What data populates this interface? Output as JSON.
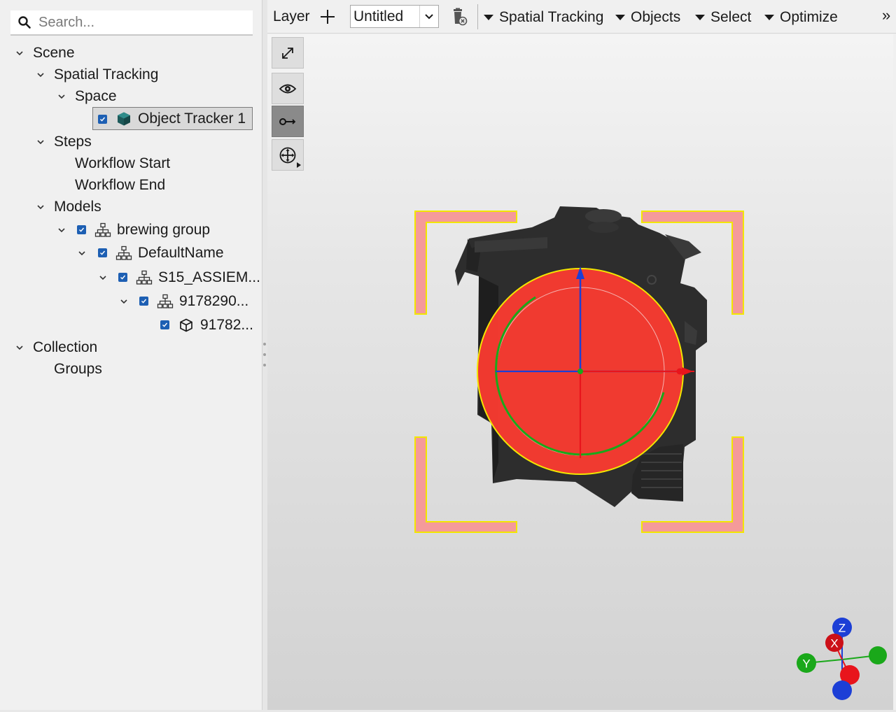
{
  "search": {
    "placeholder": "Search..."
  },
  "tree": {
    "scene": "Scene",
    "spatial_tracking": "Spatial Tracking",
    "space": "Space",
    "object_tracker": "Object Tracker 1",
    "steps": "Steps",
    "workflow_start": "Workflow Start",
    "workflow_end": "Workflow End",
    "models": "Models",
    "brewing_group": "brewing group",
    "default_name": "DefaultName",
    "s15": "S15_ASSIEM...",
    "part_group": "9178290...",
    "part_mesh": "91782...",
    "collection": "Collection",
    "groups": "Groups"
  },
  "toolbar": {
    "layer_label": "Layer",
    "layer_value": "Untitled",
    "spatial_tracking": "Spatial Tracking",
    "objects": "Objects",
    "select": "Select",
    "optimize": "Optimize",
    "overflow": "»"
  },
  "axis_gizmo": {
    "z_label": "Z",
    "x_label": "X",
    "y_label": "Y"
  },
  "colors": {
    "checkbox": "#1d5fb3",
    "gizmo_fill": "#ff3b30",
    "gizmo_outline": "#f2e600",
    "bracket_fill": "#f59a9a",
    "axis_red": "#e8141c",
    "axis_green": "#1aa81a",
    "axis_blue": "#1c3fd6"
  }
}
